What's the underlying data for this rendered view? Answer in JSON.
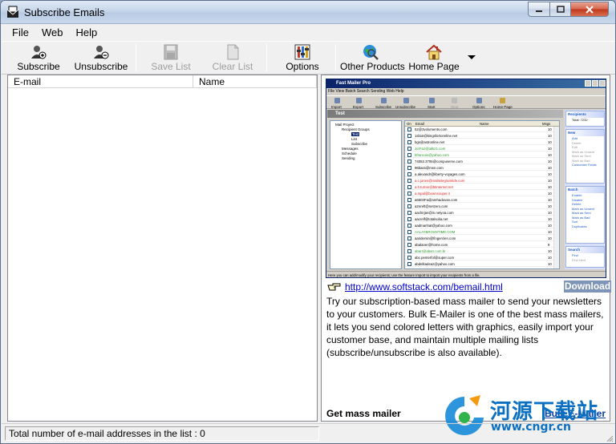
{
  "window": {
    "title": "Subscribe Emails"
  },
  "menu": [
    "File",
    "Web",
    "Help"
  ],
  "toolbar": {
    "subscribe": "Subscribe",
    "unsubscribe": "Unsubscribe",
    "save_list": "Save List",
    "clear_list": "Clear List",
    "options": "Options",
    "other_products": "Other Products",
    "home_page": "Home Page"
  },
  "list": {
    "columns": [
      "E-mail",
      "Name"
    ],
    "rows": []
  },
  "ad": {
    "screenshot": {
      "title": "Fast Mailer Pro",
      "menu": "File  View  Batch  Search  Sending  Web  Help",
      "toolbar": [
        "Import",
        "Export",
        "Subscribe",
        "Unsubscribe",
        "Start",
        "Stop",
        "Options",
        "Home Page"
      ],
      "heading": "Test",
      "tree": [
        "Mail Project",
        "Recipient Groups",
        "Test",
        "List",
        "Subscribe",
        "Messages",
        "Schedule",
        "Sending"
      ],
      "grid_columns": [
        "On",
        "Email",
        "Name",
        "Msgs"
      ],
      "rows": [
        {
          "email": "52@3voluments.com",
          "msgs": "10"
        },
        {
          "email": "1sbiot@kingsfortonnline.net",
          "msgs": "10"
        },
        {
          "email": "bgs@astronline.net",
          "msgs": "10"
        },
        {
          "email": "JorFaz@talk21.com",
          "msgs": "10"
        },
        {
          "email": "bfrancois@yahoo.com",
          "msgs": "10"
        },
        {
          "email": "74053.3706@compuserve.com",
          "msgs": "10"
        },
        {
          "email": "96bass@msn.com",
          "msgs": "10"
        },
        {
          "email": "a.alexandr@liberty-voyages.com",
          "msgs": "10"
        },
        {
          "email": "a.c.jones@mailtelegramtide.com",
          "msgs": "10"
        },
        {
          "email": "a.h.turner@btinternet.net",
          "msgs": "10"
        },
        {
          "email": "a.mpal@bownsouper.it",
          "msgs": "10"
        },
        {
          "email": "a6503Fa@arehadovan.com",
          "msgs": "10"
        },
        {
          "email": "a2nreft@netzero.com",
          "msgs": "10"
        },
        {
          "email": "aachirjan@in.netyoa.com",
          "msgs": "10"
        },
        {
          "email": "aacrelf@totalsolia.net",
          "msgs": "10"
        },
        {
          "email": "aadmanhat@yahoo.com",
          "msgs": "10"
        },
        {
          "email": "AALAYBROSNTIME.COM",
          "msgs": "10"
        },
        {
          "email": "aaridersin@fingerclen.com",
          "msgs": "10"
        },
        {
          "email": "abalaner@home.com",
          "msgs": "9"
        },
        {
          "email": "abarr@abarr.com.br",
          "msgs": "10"
        },
        {
          "email": "abc.penterfol@super.com",
          "msgs": "10"
        },
        {
          "email": "abdelkadeaz@yahoo.com",
          "msgs": "10"
        }
      ],
      "side": {
        "recipients": {
          "header": "Recipients",
          "items": [
            "Total: 7232"
          ]
        },
        "new": {
          "header": "New",
          "items": [
            "Add",
            "Delete",
            "Edit",
            "Mark as Unsent",
            "Mark as Sent",
            "Mark as Bad",
            "Customize Fields"
          ]
        },
        "batch": {
          "header": "Batch",
          "items": [
            "Enable",
            "Disable",
            "Delete",
            "Mark as Unsent",
            "Mark as Sent",
            "Mark as Bad",
            "Sort",
            "Duplicates"
          ]
        },
        "search": {
          "header": "Search",
          "items": [
            "Find",
            "Find Next"
          ]
        }
      },
      "status": "Here you can add/modify your recipients; use the feature Import to import your recipients from a file."
    },
    "url": "http://www.softstack.com/bemail.html",
    "download": "Download",
    "description": "Try our subscription-based mass mailer to send your newsletters to your customers. Bulk E-Mailer is one of the best mass mailers, it lets you send colored letters with graphics, easily import your customer base, and maintain multiple mailing lists (subscribe/unsubscribe is also available).",
    "get_label": "Get mass mailer",
    "product_link": "Bulk E-Mailer"
  },
  "watermark": {
    "title": "河源下载站",
    "url": "www.cngr.cn"
  },
  "status": {
    "label": "Total number of e-mail addresses in the list : ",
    "count": "0"
  },
  "colors": {
    "link": "#0000cc",
    "download_bg": "#7f95b7",
    "watermark": "#0b6fc2"
  }
}
